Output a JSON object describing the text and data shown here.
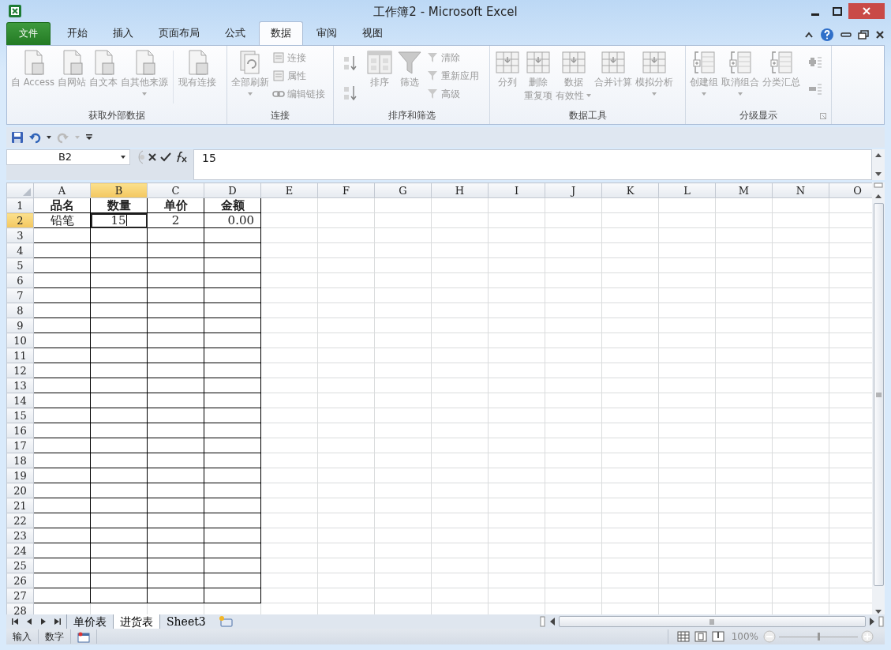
{
  "window": {
    "title": "工作簿2 - Microsoft Excel"
  },
  "ribbon_tabs": [
    {
      "label": "文件",
      "kind": "file",
      "selected": false
    },
    {
      "label": "开始",
      "kind": "tab",
      "selected": false
    },
    {
      "label": "插入",
      "kind": "tab",
      "selected": false
    },
    {
      "label": "页面布局",
      "kind": "tab",
      "selected": false
    },
    {
      "label": "公式",
      "kind": "tab",
      "selected": false
    },
    {
      "label": "数据",
      "kind": "tab",
      "selected": true
    },
    {
      "label": "审阅",
      "kind": "tab",
      "selected": false
    },
    {
      "label": "视图",
      "kind": "tab",
      "selected": false
    }
  ],
  "ribbon": {
    "disabled": true,
    "groups": [
      {
        "label": "获取外部数据",
        "launcher": false,
        "items": [
          {
            "kind": "large",
            "label": "自 Access",
            "dropdown": false
          },
          {
            "kind": "large",
            "label": "自网站",
            "dropdown": false
          },
          {
            "kind": "large",
            "label": "自文本",
            "dropdown": false
          },
          {
            "kind": "large",
            "label": "自其他来源",
            "dropdown": true
          },
          {
            "kind": "large",
            "label": "现有连接",
            "dropdown": false
          }
        ]
      },
      {
        "label": "连接",
        "launcher": false,
        "items": [
          {
            "kind": "large",
            "label": "全部刷新",
            "dropdown": true
          },
          {
            "kind": "small",
            "label": "连接"
          },
          {
            "kind": "small",
            "label": "属性"
          },
          {
            "kind": "small",
            "label": "编辑链接"
          }
        ]
      },
      {
        "label": "排序和筛选",
        "launcher": false,
        "items": [
          {
            "kind": "icon"
          },
          {
            "kind": "icon"
          },
          {
            "kind": "large",
            "label": "排序",
            "dropdown": false
          },
          {
            "kind": "large",
            "label": "筛选",
            "dropdown": false
          },
          {
            "kind": "small",
            "label": "清除"
          },
          {
            "kind": "small",
            "label": "重新应用"
          },
          {
            "kind": "small",
            "label": "高级"
          }
        ]
      },
      {
        "label": "数据工具",
        "launcher": false,
        "items": [
          {
            "kind": "large",
            "label": "分列",
            "dropdown": false
          },
          {
            "kind": "large",
            "lines": [
              "删除",
              "重复项"
            ],
            "dropdown": false
          },
          {
            "kind": "large",
            "lines": [
              "数据",
              "有效性"
            ],
            "dropdown": true
          },
          {
            "kind": "large",
            "label": "合并计算",
            "dropdown": false
          },
          {
            "kind": "large",
            "label": "模拟分析",
            "dropdown": true
          }
        ]
      },
      {
        "label": "分级显示",
        "launcher": true,
        "items": [
          {
            "kind": "large",
            "label": "创建组",
            "dropdown": true
          },
          {
            "kind": "large",
            "label": "取消组合",
            "dropdown": true
          },
          {
            "kind": "large",
            "label": "分类汇总",
            "dropdown": false
          },
          {
            "kind": "icon"
          },
          {
            "kind": "icon"
          }
        ]
      }
    ]
  },
  "formula_bar": {
    "name_box": "B2",
    "value": "15"
  },
  "grid": {
    "editing": true,
    "columns": [
      {
        "label": "A",
        "selected": false
      },
      {
        "label": "B",
        "selected": true
      },
      {
        "label": "C",
        "selected": false
      },
      {
        "label": "D",
        "selected": false
      },
      {
        "label": "E",
        "selected": false
      },
      {
        "label": "F",
        "selected": false
      },
      {
        "label": "G",
        "selected": false
      },
      {
        "label": "H",
        "selected": false
      },
      {
        "label": "I",
        "selected": false
      },
      {
        "label": "J",
        "selected": false
      },
      {
        "label": "K",
        "selected": false
      },
      {
        "label": "L",
        "selected": false
      },
      {
        "label": "M",
        "selected": false
      },
      {
        "label": "N",
        "selected": false
      },
      {
        "label": "O",
        "selected": false
      }
    ],
    "rows": [
      {
        "number": "1",
        "selected": false,
        "bordered": true,
        "kind": "header",
        "cells": [
          "品名",
          "数量",
          "单价",
          "金额"
        ]
      },
      {
        "number": "2",
        "selected": true,
        "bordered": true,
        "kind": "data",
        "cells": [
          "铅笔",
          "15",
          "2",
          "0.00"
        ]
      },
      {
        "number": "3",
        "selected": false,
        "bordered": true
      },
      {
        "number": "4",
        "selected": false,
        "bordered": true
      },
      {
        "number": "5",
        "selected": false,
        "bordered": true
      },
      {
        "number": "6",
        "selected": false,
        "bordered": true
      },
      {
        "number": "7",
        "selected": false,
        "bordered": true
      },
      {
        "number": "8",
        "selected": false,
        "bordered": true
      },
      {
        "number": "9",
        "selected": false,
        "bordered": true
      },
      {
        "number": "10",
        "selected": false,
        "bordered": true
      },
      {
        "number": "11",
        "selected": false,
        "bordered": true
      },
      {
        "number": "12",
        "selected": false,
        "bordered": true
      },
      {
        "number": "13",
        "selected": false,
        "bordered": true
      },
      {
        "number": "14",
        "selected": false,
        "bordered": true
      },
      {
        "number": "15",
        "selected": false,
        "bordered": true
      },
      {
        "number": "16",
        "selected": false,
        "bordered": true
      },
      {
        "number": "17",
        "selected": false,
        "bordered": true
      },
      {
        "number": "18",
        "selected": false,
        "bordered": true
      },
      {
        "number": "19",
        "selected": false,
        "bordered": true
      },
      {
        "number": "20",
        "selected": false,
        "bordered": true
      },
      {
        "number": "21",
        "selected": false,
        "bordered": true
      },
      {
        "number": "22",
        "selected": false,
        "bordered": true
      },
      {
        "number": "23",
        "selected": false,
        "bordered": true
      },
      {
        "number": "24",
        "selected": false,
        "bordered": true
      },
      {
        "number": "25",
        "selected": false,
        "bordered": true
      },
      {
        "number": "26",
        "selected": false,
        "bordered": true
      },
      {
        "number": "27",
        "selected": false,
        "bordered": true
      },
      {
        "number": "28",
        "selected": false,
        "bordered": false
      }
    ]
  },
  "sheet_tabs": [
    {
      "label": "单价表",
      "selected": false
    },
    {
      "label": "进货表",
      "selected": true
    },
    {
      "label": "Sheet3",
      "selected": false
    }
  ],
  "status_bar": {
    "items": [
      "输入",
      "数字"
    ],
    "zoom": "100%",
    "zoom_slider": {
      "level": 0.5
    }
  }
}
